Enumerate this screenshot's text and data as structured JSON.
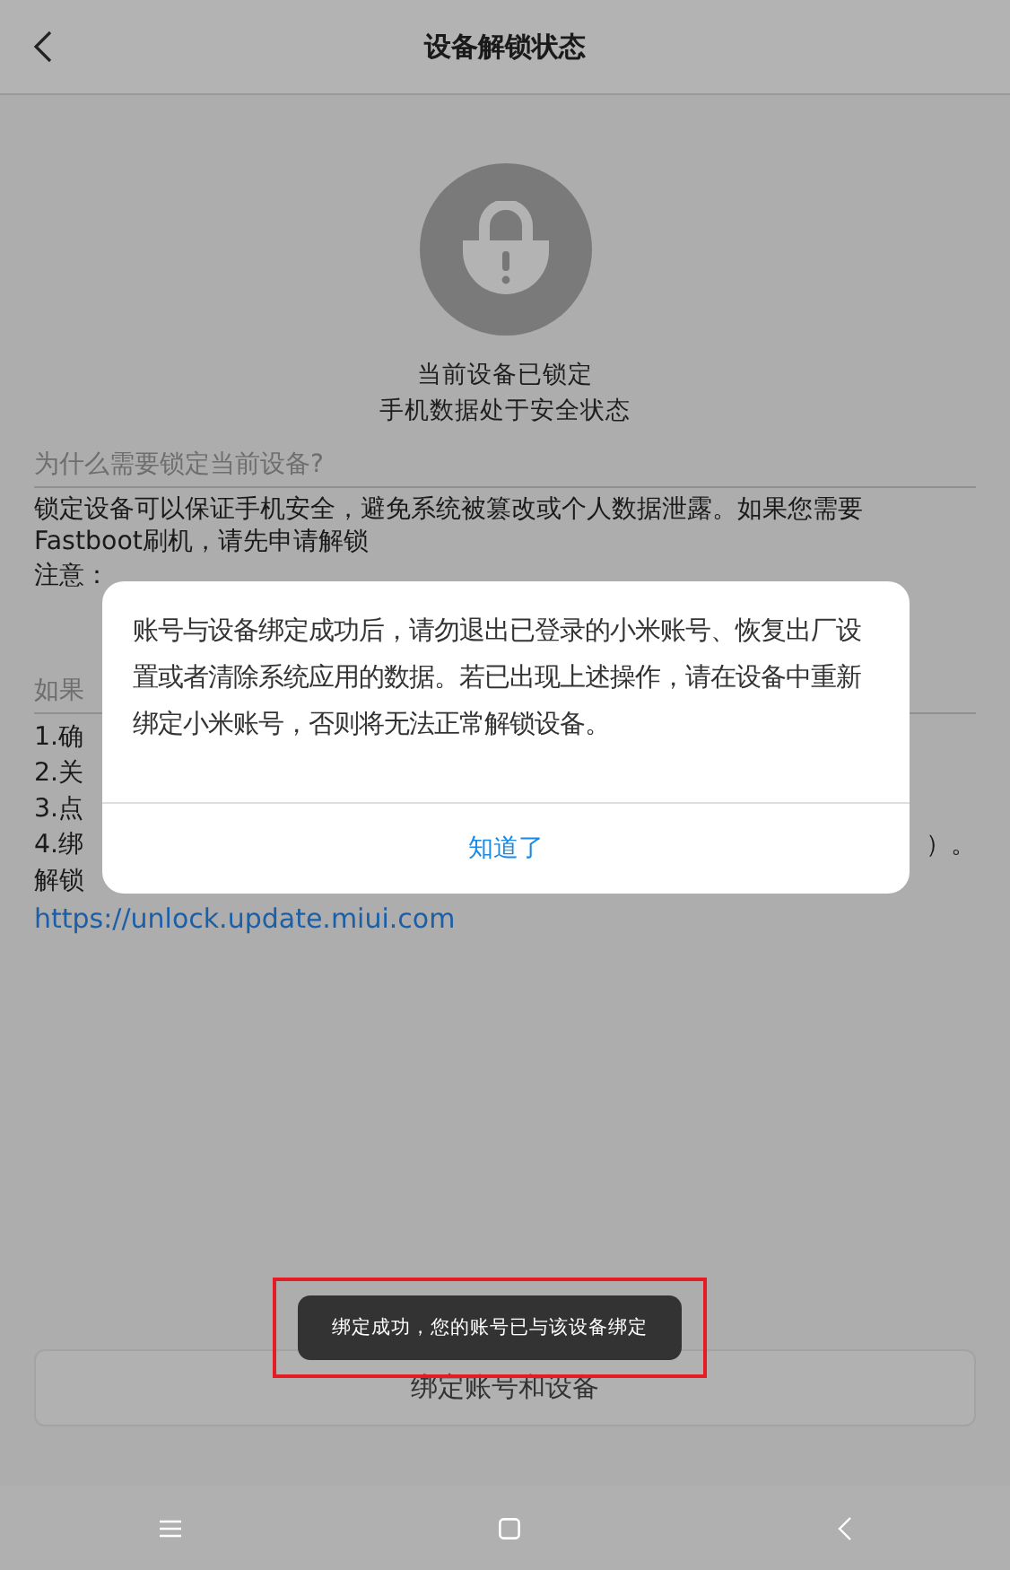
{
  "header": {
    "title": "设备解锁状态"
  },
  "status": {
    "locked": true,
    "lines": [
      "当前设备已锁定",
      "手机数据处于安全状态"
    ]
  },
  "why_section": {
    "heading": "为什么需要锁定当前设备?",
    "paragraph_lines": [
      "锁定设备可以保证手机安全，避免系统被篡改或个人数据泄露。如果您需要",
      "Fastboot刷机，请先申请解锁"
    ],
    "note": "注意："
  },
  "how_section": {
    "heading": "如果",
    "steps": [
      {
        "text": "1.确"
      },
      {
        "text": "2.关"
      },
      {
        "text": "3.点"
      },
      {
        "text": "4.绑",
        "tail": "）。"
      },
      {
        "text": "解锁"
      }
    ],
    "link": "https://unlock.update.miui.com"
  },
  "bind_button": {
    "label": "绑定账号和设备"
  },
  "dialog": {
    "message": "账号与设备绑定成功后，请勿退出已登录的小米账号、恢复出厂设置或者清除系统应用的数据。若已出现上述操作，请在设备中重新绑定小米账号，否则将无法正常解锁设备。",
    "button": "知道了"
  },
  "toast": {
    "text": "绑定成功，您的账号已与该设备绑定",
    "highlighted": true
  },
  "nav_bar": {
    "buttons": [
      {
        "kind": "menu"
      },
      {
        "kind": "home"
      },
      {
        "kind": "back"
      }
    ]
  }
}
